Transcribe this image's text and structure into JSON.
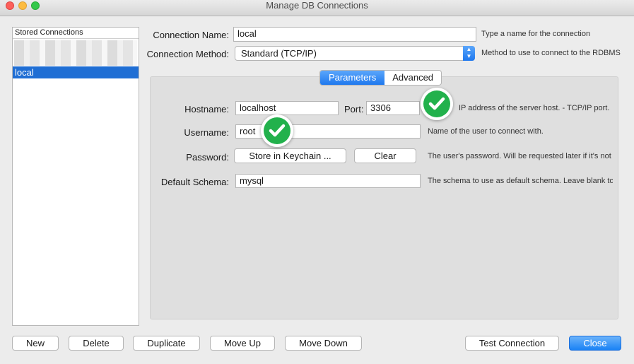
{
  "window": {
    "title": "Manage DB Connections"
  },
  "sidebar": {
    "header": "Stored Connections",
    "items": [
      {
        "label": "local",
        "selected": true
      }
    ]
  },
  "connection": {
    "name_label": "Connection Name:",
    "name_value": "local",
    "name_hint": "Type a name for the connection",
    "method_label": "Connection Method:",
    "method_value": "Standard (TCP/IP)",
    "method_hint": "Method to use to connect to the RDBMS"
  },
  "tabs": [
    {
      "label": "Parameters",
      "active": true
    },
    {
      "label": "Advanced",
      "active": false
    }
  ],
  "parameters": {
    "hostname_label": "Hostname:",
    "hostname_value": "localhost",
    "port_label": "Port:",
    "port_value": "3306",
    "host_hint": "IP address of the server host. - TCP/IP port.",
    "username_label": "Username:",
    "username_value": "root",
    "username_hint": "Name of the user to connect with.",
    "password_label": "Password:",
    "store_keychain_label": "Store in Keychain ...",
    "clear_label": "Clear",
    "password_hint": "The user's password. Will be requested later if it's not",
    "schema_label": "Default Schema:",
    "schema_value": "mysql",
    "schema_hint": "The schema to use as default schema. Leave blank to"
  },
  "footer": {
    "new_label": "New",
    "delete_label": "Delete",
    "duplicate_label": "Duplicate",
    "move_up_label": "Move Up",
    "move_down_label": "Move Down",
    "test_connection_label": "Test Connection",
    "close_label": "Close"
  },
  "colors": {
    "accent": "#1f78ee",
    "selection": "#1f6ed4",
    "check_green": "#22b14c"
  },
  "icons": {
    "overlay": "check-circle-icon",
    "select_arrows": "up-down-arrows-icon"
  }
}
